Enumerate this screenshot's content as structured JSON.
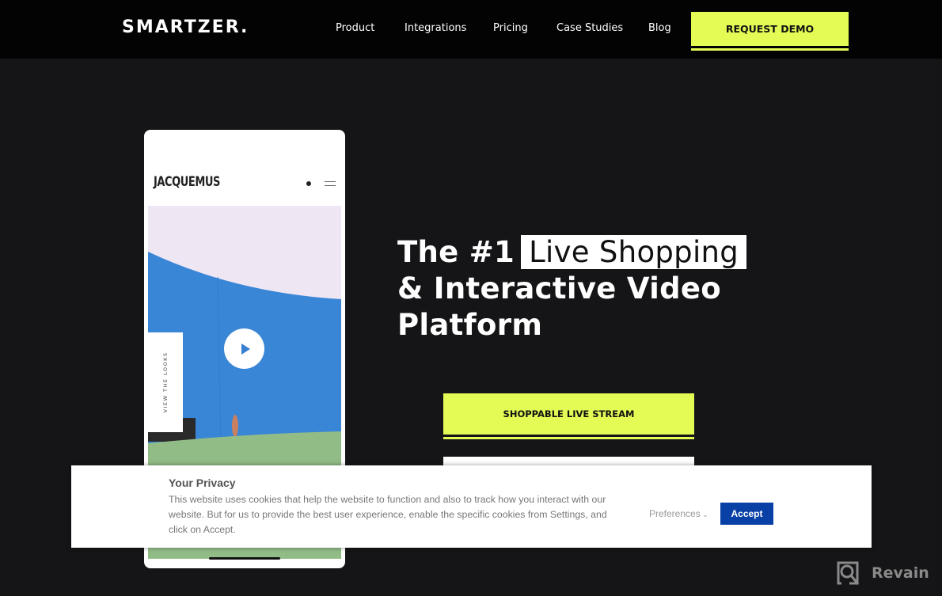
{
  "nav": {
    "logo": "SMARTZER.",
    "links": [
      "Product",
      "Integrations",
      "Pricing",
      "Case Studies",
      "Blog"
    ],
    "cta": "REQUEST DEMO"
  },
  "phone": {
    "brand": "JACQUEMUS",
    "side_tab": "VIEW THE LOOKS"
  },
  "hero": {
    "title_prefix": "The #1",
    "title_highlight": "Live Shopping",
    "title_line2": "& Interactive Video",
    "title_line3": "Platform",
    "primary_button": "SHOPPABLE LIVE STREAM"
  },
  "cookie": {
    "title": "Your Privacy",
    "text": "This website uses cookies that help the website to function and also to track how you interact with our website. But for us to provide the best user experience, enable the specific cookies from Settings, and click on Accept.",
    "preferences": "Preferences",
    "accept": "Accept"
  },
  "watermark": "Revain",
  "colors": {
    "accent": "#e5fb55",
    "background": "#151517",
    "accept_blue": "#0940a6"
  }
}
